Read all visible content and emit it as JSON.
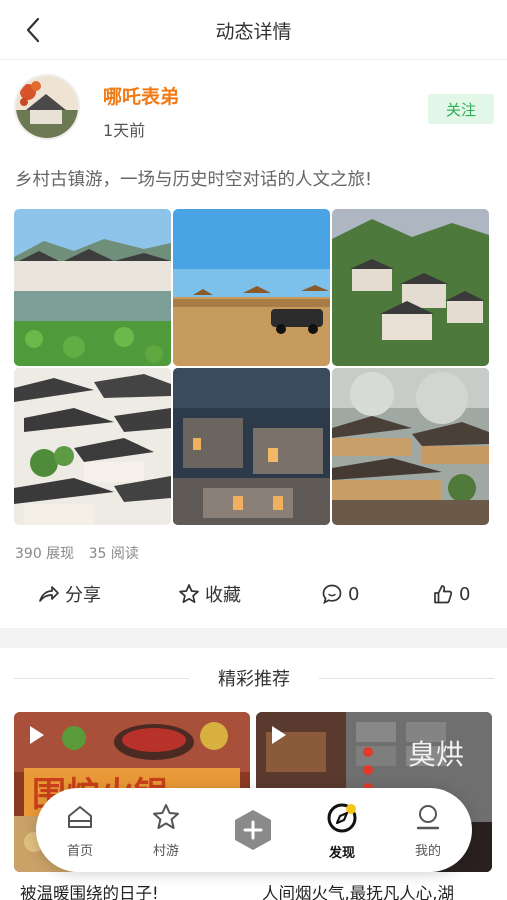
{
  "header": {
    "title": "动态详情",
    "back_icon": "chevron-left-icon"
  },
  "author": {
    "name": "哪吒表弟",
    "time": "1天前",
    "follow_label": "关注"
  },
  "post": {
    "text": "乡村古镇游，一场与历史时空对话的人文之旅!"
  },
  "stats": {
    "views": "390 展现",
    "reads": "35 阅读"
  },
  "actions": {
    "share_label": "分享",
    "collect_label": "收藏",
    "comment_count": "0",
    "like_count": "0"
  },
  "section": {
    "title": "精彩推荐"
  },
  "recommendations": [
    {
      "title": "被温暖围绕的日子!",
      "overlay": "围炉火锅"
    },
    {
      "title": "人间烟火气,最抚凡人心,湖",
      "overlay": "臭烘"
    }
  ],
  "tabbar": {
    "items": [
      {
        "label": "首页",
        "icon": "home-icon"
      },
      {
        "label": "村游",
        "icon": "star-icon"
      },
      {
        "label": "",
        "icon": "plus-icon"
      },
      {
        "label": "发现",
        "icon": "compass-icon"
      },
      {
        "label": "我的",
        "icon": "user-icon"
      }
    ],
    "active": "发现"
  },
  "colors": {
    "accent": "#f07a16",
    "follow_bg": "#e3f7e9",
    "follow_text": "#2fae55"
  }
}
